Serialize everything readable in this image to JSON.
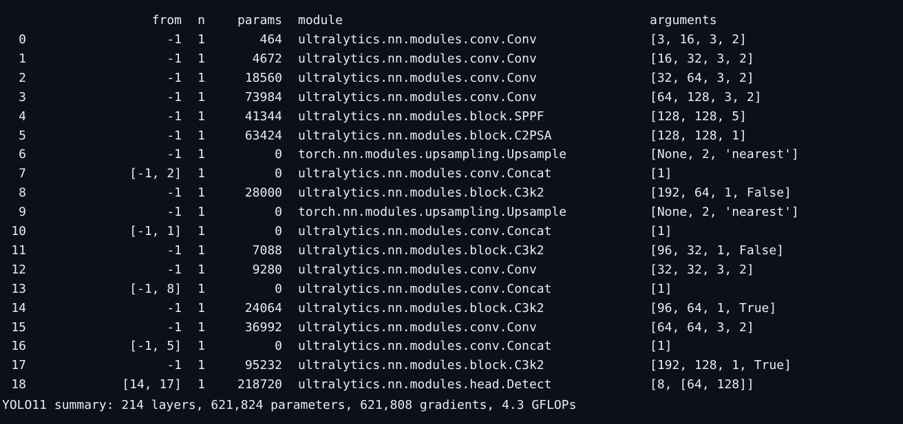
{
  "header": {
    "from": "from",
    "n": "n",
    "params": "params",
    "module": "module",
    "arguments": "arguments"
  },
  "rows": [
    {
      "idx": "0",
      "from": "-1",
      "n": "1",
      "params": "464",
      "module": "ultralytics.nn.modules.conv.Conv",
      "arguments": "[3, 16, 3, 2]"
    },
    {
      "idx": "1",
      "from": "-1",
      "n": "1",
      "params": "4672",
      "module": "ultralytics.nn.modules.conv.Conv",
      "arguments": "[16, 32, 3, 2]"
    },
    {
      "idx": "2",
      "from": "-1",
      "n": "1",
      "params": "18560",
      "module": "ultralytics.nn.modules.conv.Conv",
      "arguments": "[32, 64, 3, 2]"
    },
    {
      "idx": "3",
      "from": "-1",
      "n": "1",
      "params": "73984",
      "module": "ultralytics.nn.modules.conv.Conv",
      "arguments": "[64, 128, 3, 2]"
    },
    {
      "idx": "4",
      "from": "-1",
      "n": "1",
      "params": "41344",
      "module": "ultralytics.nn.modules.block.SPPF",
      "arguments": "[128, 128, 5]"
    },
    {
      "idx": "5",
      "from": "-1",
      "n": "1",
      "params": "63424",
      "module": "ultralytics.nn.modules.block.C2PSA",
      "arguments": "[128, 128, 1]"
    },
    {
      "idx": "6",
      "from": "-1",
      "n": "1",
      "params": "0",
      "module": "torch.nn.modules.upsampling.Upsample",
      "arguments": "[None, 2, 'nearest']"
    },
    {
      "idx": "7",
      "from": "[-1, 2]",
      "n": "1",
      "params": "0",
      "module": "ultralytics.nn.modules.conv.Concat",
      "arguments": "[1]"
    },
    {
      "idx": "8",
      "from": "-1",
      "n": "1",
      "params": "28000",
      "module": "ultralytics.nn.modules.block.C3k2",
      "arguments": "[192, 64, 1, False]"
    },
    {
      "idx": "9",
      "from": "-1",
      "n": "1",
      "params": "0",
      "module": "torch.nn.modules.upsampling.Upsample",
      "arguments": "[None, 2, 'nearest']"
    },
    {
      "idx": "10",
      "from": "[-1, 1]",
      "n": "1",
      "params": "0",
      "module": "ultralytics.nn.modules.conv.Concat",
      "arguments": "[1]"
    },
    {
      "idx": "11",
      "from": "-1",
      "n": "1",
      "params": "7088",
      "module": "ultralytics.nn.modules.block.C3k2",
      "arguments": "[96, 32, 1, False]"
    },
    {
      "idx": "12",
      "from": "-1",
      "n": "1",
      "params": "9280",
      "module": "ultralytics.nn.modules.conv.Conv",
      "arguments": "[32, 32, 3, 2]"
    },
    {
      "idx": "13",
      "from": "[-1, 8]",
      "n": "1",
      "params": "0",
      "module": "ultralytics.nn.modules.conv.Concat",
      "arguments": "[1]"
    },
    {
      "idx": "14",
      "from": "-1",
      "n": "1",
      "params": "24064",
      "module": "ultralytics.nn.modules.block.C3k2",
      "arguments": "[96, 64, 1, True]"
    },
    {
      "idx": "15",
      "from": "-1",
      "n": "1",
      "params": "36992",
      "module": "ultralytics.nn.modules.conv.Conv",
      "arguments": "[64, 64, 3, 2]"
    },
    {
      "idx": "16",
      "from": "[-1, 5]",
      "n": "1",
      "params": "0",
      "module": "ultralytics.nn.modules.conv.Concat",
      "arguments": "[1]"
    },
    {
      "idx": "17",
      "from": "-1",
      "n": "1",
      "params": "95232",
      "module": "ultralytics.nn.modules.block.C3k2",
      "arguments": "[192, 128, 1, True]"
    },
    {
      "idx": "18",
      "from": "[14, 17]",
      "n": "1",
      "params": "218720",
      "module": "ultralytics.nn.modules.head.Detect",
      "arguments": "[8, [64, 128]]"
    }
  ],
  "summary": "YOLO11 summary: 214 layers, 621,824 parameters, 621,808 gradients, 4.3 GFLOPs",
  "colors": {
    "background": "#0d1117",
    "text": "#e6edf3"
  }
}
